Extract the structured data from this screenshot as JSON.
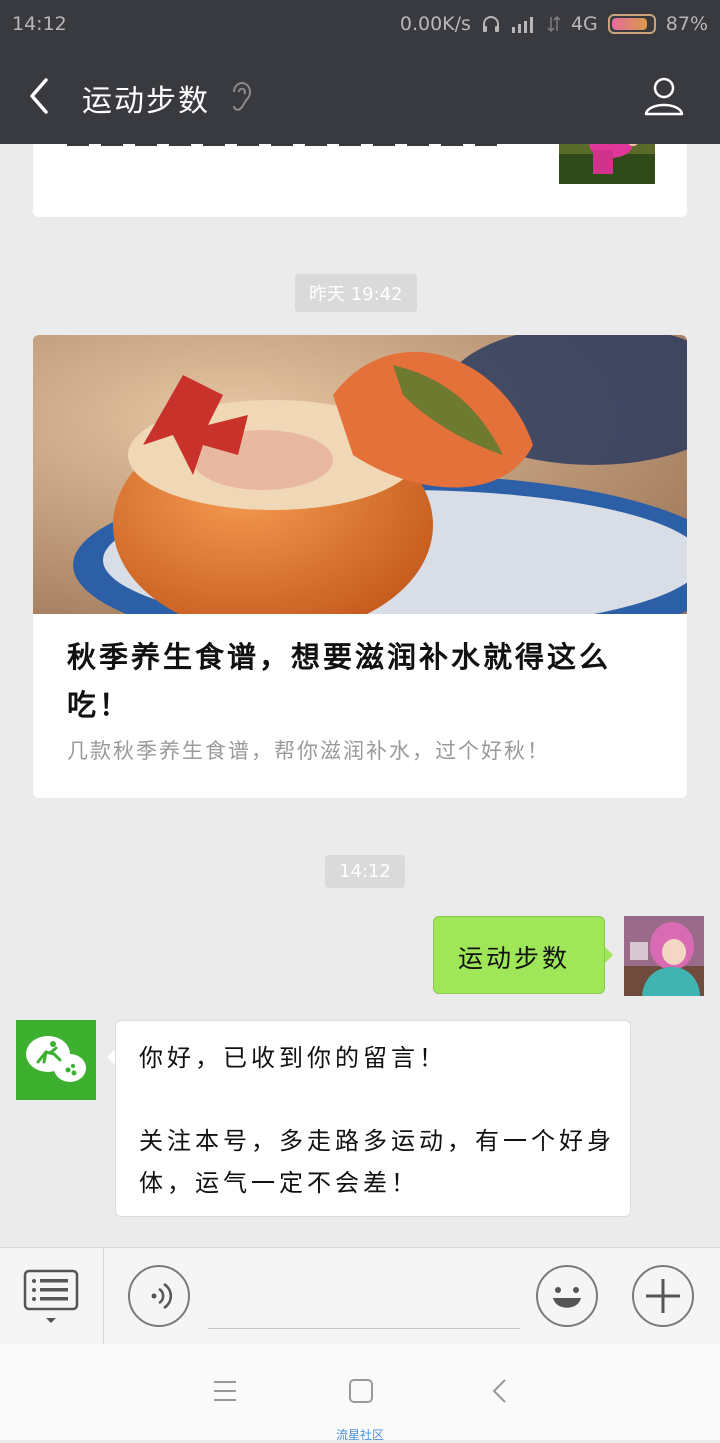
{
  "status_bar": {
    "time": "14:12",
    "net_speed": "0.00K/s",
    "network": "4G",
    "battery": "87%",
    "battery_level": 0.87
  },
  "header": {
    "title": "运动步数",
    "icons": {
      "back": "back-arrow-icon",
      "ear": "ear-icon",
      "profile": "person-icon"
    }
  },
  "chat": {
    "timestamps": [
      "昨天 19:42",
      "14:12"
    ],
    "article": {
      "title": "秋季养生食谱，想要滋润补水就得这么吃！",
      "description": "几款秋季养生食谱，帮你滋润补水，过个好秋！"
    },
    "user_message": "运动步数",
    "bot_reply": {
      "line1": "你好，已收到你的留言！",
      "line2": "关注本号，多走路多运动，有一个好身体，运气一定不会差！"
    }
  },
  "input_bar": {
    "icons": {
      "menu": "menu-list-icon",
      "voice": "voice-icon",
      "emoji": "emoji-icon",
      "plus": "plus-icon"
    }
  },
  "system_nav": {
    "icons": [
      "menu-icon",
      "home-square-icon",
      "back-triangle-icon"
    ],
    "watermark": "流星社区"
  },
  "colors": {
    "header_bg": "#393a3f",
    "chat_bg": "#ebebeb",
    "user_bubble": "#9fe658",
    "bot_avatar": "#3db030"
  }
}
